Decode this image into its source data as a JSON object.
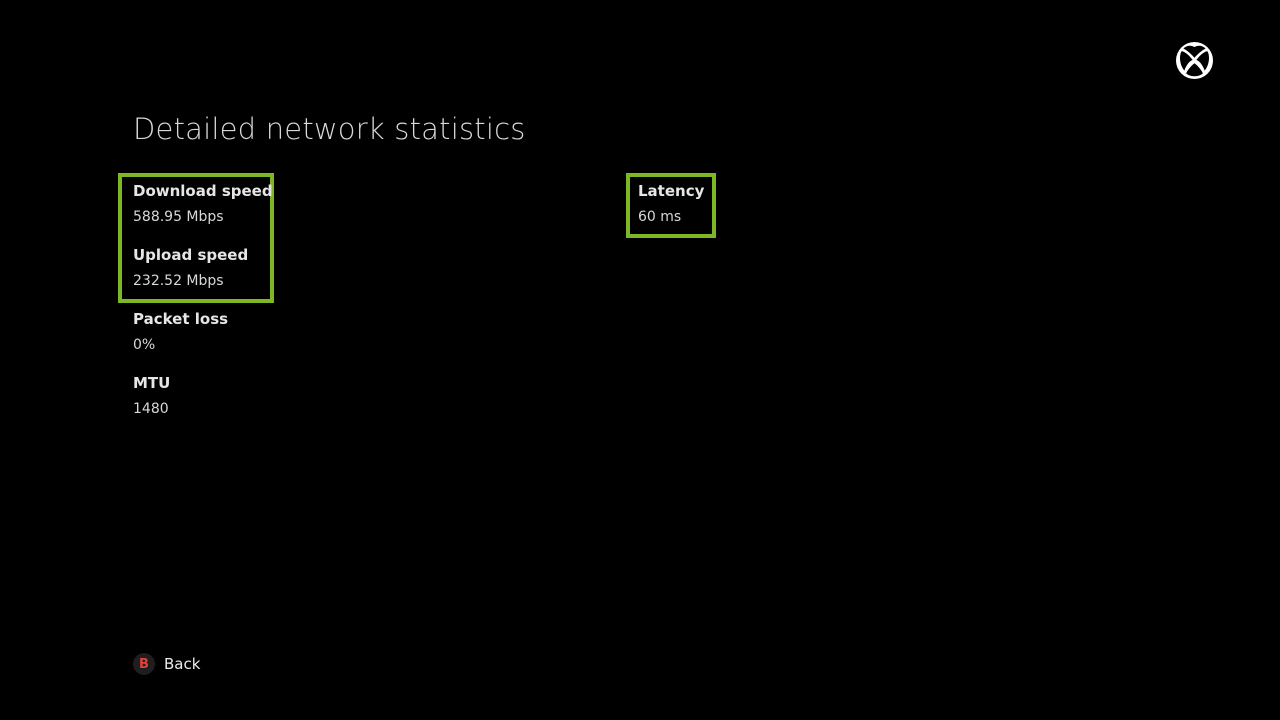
{
  "header": {
    "title": "Detailed network statistics",
    "logo_icon": "xbox-logo-icon"
  },
  "stats": {
    "download": {
      "label": "Download speed",
      "value": "588.95 Mbps"
    },
    "upload": {
      "label": "Upload speed",
      "value": "232.52 Mbps"
    },
    "packet_loss": {
      "label": "Packet loss",
      "value": "0%"
    },
    "mtu": {
      "label": "MTU",
      "value": "1480"
    },
    "latency": {
      "label": "Latency",
      "value": "60 ms"
    }
  },
  "footer": {
    "back_button": {
      "key": "B",
      "label": "Back"
    }
  },
  "colors": {
    "background": "#000000",
    "highlight": "#7db824",
    "b_button": "#e2403a"
  }
}
